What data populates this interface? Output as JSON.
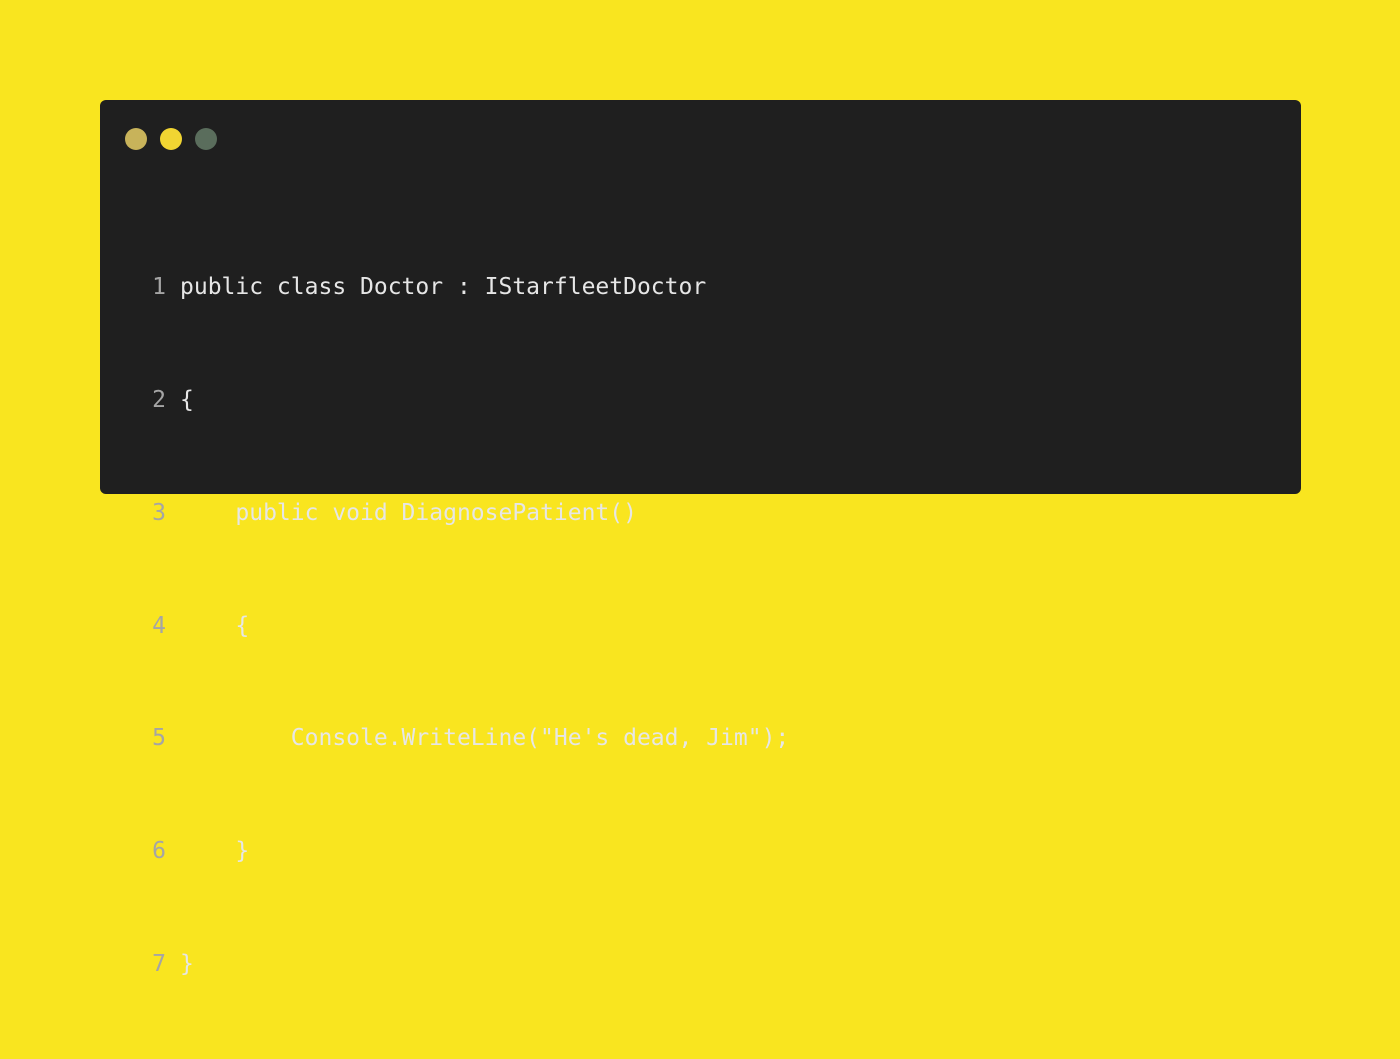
{
  "window": {
    "controls": [
      "close",
      "minimize",
      "maximize"
    ]
  },
  "code": {
    "lines": [
      {
        "number": "1",
        "text": "public class Doctor : IStarfleetDoctor"
      },
      {
        "number": "2",
        "text": "{"
      },
      {
        "number": "3",
        "text": "    public void DiagnosePatient()"
      },
      {
        "number": "4",
        "text": "    {"
      },
      {
        "number": "5",
        "text": "        Console.WriteLine(\"He's dead, Jim\");"
      },
      {
        "number": "6",
        "text": "    }"
      },
      {
        "number": "7",
        "text": "}"
      }
    ]
  },
  "colors": {
    "background": "#f9e51f",
    "window": "#1f1f1f",
    "dot_close": "#c8b35a",
    "dot_minimize": "#f1d532",
    "dot_maximize": "#5a6d5c",
    "code_text": "#e6e6e6",
    "line_number": "#a5a5a5"
  }
}
